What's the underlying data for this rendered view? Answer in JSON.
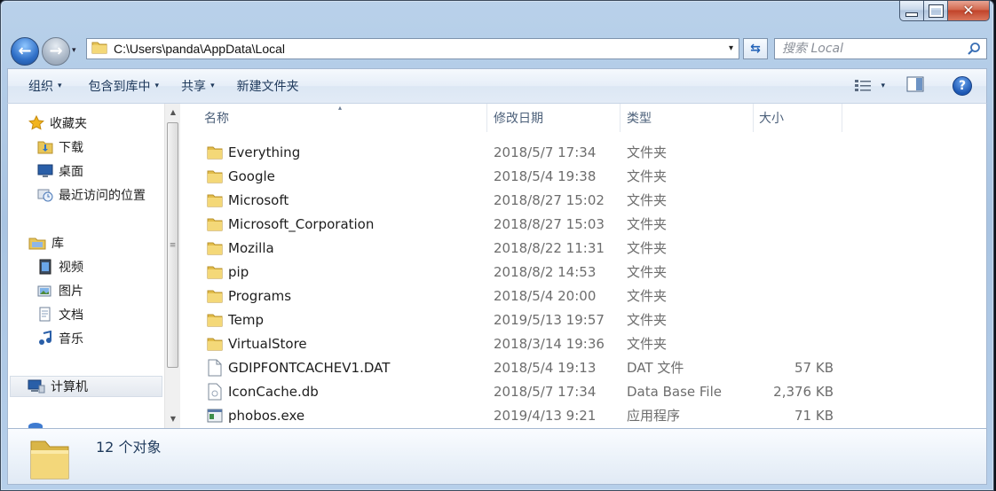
{
  "window": {
    "caption_min": "–",
    "caption_max": "□",
    "caption_close": "✕"
  },
  "nav": {
    "back_symbol": "←",
    "forward_symbol": "→",
    "recent_symbol": "▾"
  },
  "address": {
    "path": "C:\\Users\\panda\\AppData\\Local",
    "dropdown_symbol": "▾",
    "refresh_symbol": "⇆"
  },
  "search": {
    "placeholder": "搜索 Local"
  },
  "toolbar": {
    "organize": "组织",
    "include_in_library": "包含到库中",
    "share": "共享",
    "new_folder": "新建文件夹",
    "caret": "▾",
    "help_symbol": "?"
  },
  "sidebar": {
    "favorites": {
      "label": "收藏夹",
      "icon": "star-icon"
    },
    "favorite_items": [
      {
        "label": "下载",
        "icon": "downloads-icon"
      },
      {
        "label": "桌面",
        "icon": "desktop-icon"
      },
      {
        "label": "最近访问的位置",
        "icon": "recent-places-icon"
      }
    ],
    "libraries": {
      "label": "库",
      "icon": "library-icon"
    },
    "library_items": [
      {
        "label": "视频",
        "icon": "videos-icon"
      },
      {
        "label": "图片",
        "icon": "pictures-icon"
      },
      {
        "label": "文档",
        "icon": "documents-icon"
      },
      {
        "label": "音乐",
        "icon": "music-icon"
      }
    ],
    "computer": {
      "label": "计算机",
      "icon": "computer-icon"
    }
  },
  "columns": {
    "name": "名称",
    "date": "修改日期",
    "type": "类型",
    "size": "大小",
    "sort_symbol": "▴"
  },
  "files": [
    {
      "name": "Everything",
      "date": "2018/5/7 17:34",
      "type": "文件夹",
      "size": "",
      "icon": "folder-icon"
    },
    {
      "name": "Google",
      "date": "2018/5/4 19:38",
      "type": "文件夹",
      "size": "",
      "icon": "folder-icon"
    },
    {
      "name": "Microsoft",
      "date": "2018/8/27 15:02",
      "type": "文件夹",
      "size": "",
      "icon": "folder-icon"
    },
    {
      "name": "Microsoft_Corporation",
      "date": "2018/8/27 15:03",
      "type": "文件夹",
      "size": "",
      "icon": "folder-icon"
    },
    {
      "name": "Mozilla",
      "date": "2018/8/22 11:31",
      "type": "文件夹",
      "size": "",
      "icon": "folder-icon"
    },
    {
      "name": "pip",
      "date": "2018/8/2 14:53",
      "type": "文件夹",
      "size": "",
      "icon": "folder-icon"
    },
    {
      "name": "Programs",
      "date": "2018/5/4 20:00",
      "type": "文件夹",
      "size": "",
      "icon": "folder-icon"
    },
    {
      "name": "Temp",
      "date": "2019/5/13 19:57",
      "type": "文件夹",
      "size": "",
      "icon": "folder-icon"
    },
    {
      "name": "VirtualStore",
      "date": "2018/3/14 19:36",
      "type": "文件夹",
      "size": "",
      "icon": "folder-icon"
    },
    {
      "name": "GDIPFONTCACHEV1.DAT",
      "date": "2018/5/4 19:13",
      "type": "DAT 文件",
      "size": "57 KB",
      "icon": "file-icon"
    },
    {
      "name": "IconCache.db",
      "date": "2018/5/7 17:34",
      "type": "Data Base File",
      "size": "2,376 KB",
      "icon": "db-file-icon"
    },
    {
      "name": "phobos.exe",
      "date": "2019/4/13 9:21",
      "type": "应用程序",
      "size": "71 KB",
      "icon": "exe-icon"
    }
  ],
  "details": {
    "count": "12 个对象",
    "icon": "folder-large-icon"
  },
  "scroll": {
    "up": "▲",
    "down": "▼",
    "grip": "≡"
  }
}
